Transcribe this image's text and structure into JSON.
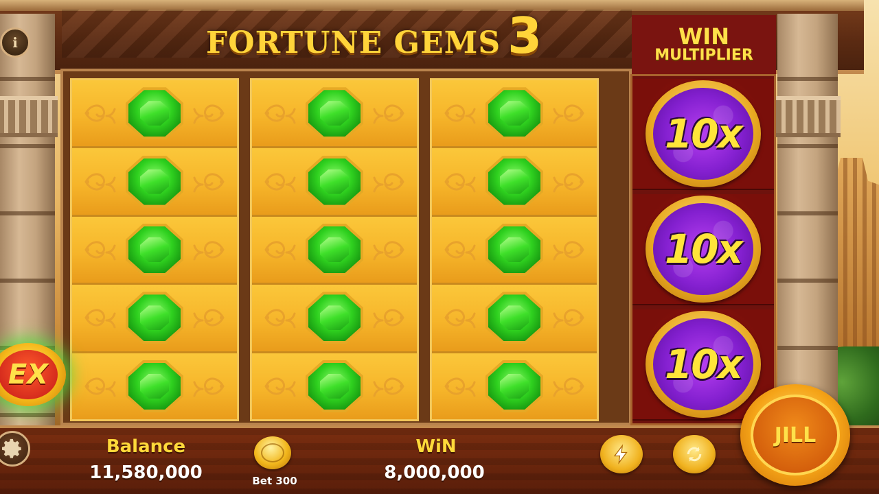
{
  "title": {
    "name": "FORTUNE GEMS",
    "number": "3"
  },
  "win_multiplier": {
    "line1": "WIN",
    "line2": "MULTIPLIER",
    "values": [
      "10x",
      "10x",
      "10x"
    ]
  },
  "reels": [
    [
      "green-gem",
      "green-gem",
      "green-gem",
      "green-gem",
      "green-gem"
    ],
    [
      "green-gem",
      "green-gem",
      "green-gem",
      "green-gem",
      "green-gem"
    ],
    [
      "green-gem",
      "green-gem",
      "green-gem",
      "green-gem",
      "green-gem"
    ]
  ],
  "buttons": {
    "info": "i",
    "extra": "EX",
    "spin": "JILL"
  },
  "balance": {
    "label": "Balance",
    "value": "11,580,000"
  },
  "bet": {
    "label": "Bet 300"
  },
  "win": {
    "label": "WiN",
    "value": "8,000,000"
  },
  "colors": {
    "gold": "#ffd43a",
    "gem_green": "#2fd11f",
    "multiplier_purple": "#8420d0",
    "panel_red": "#7a1410"
  }
}
